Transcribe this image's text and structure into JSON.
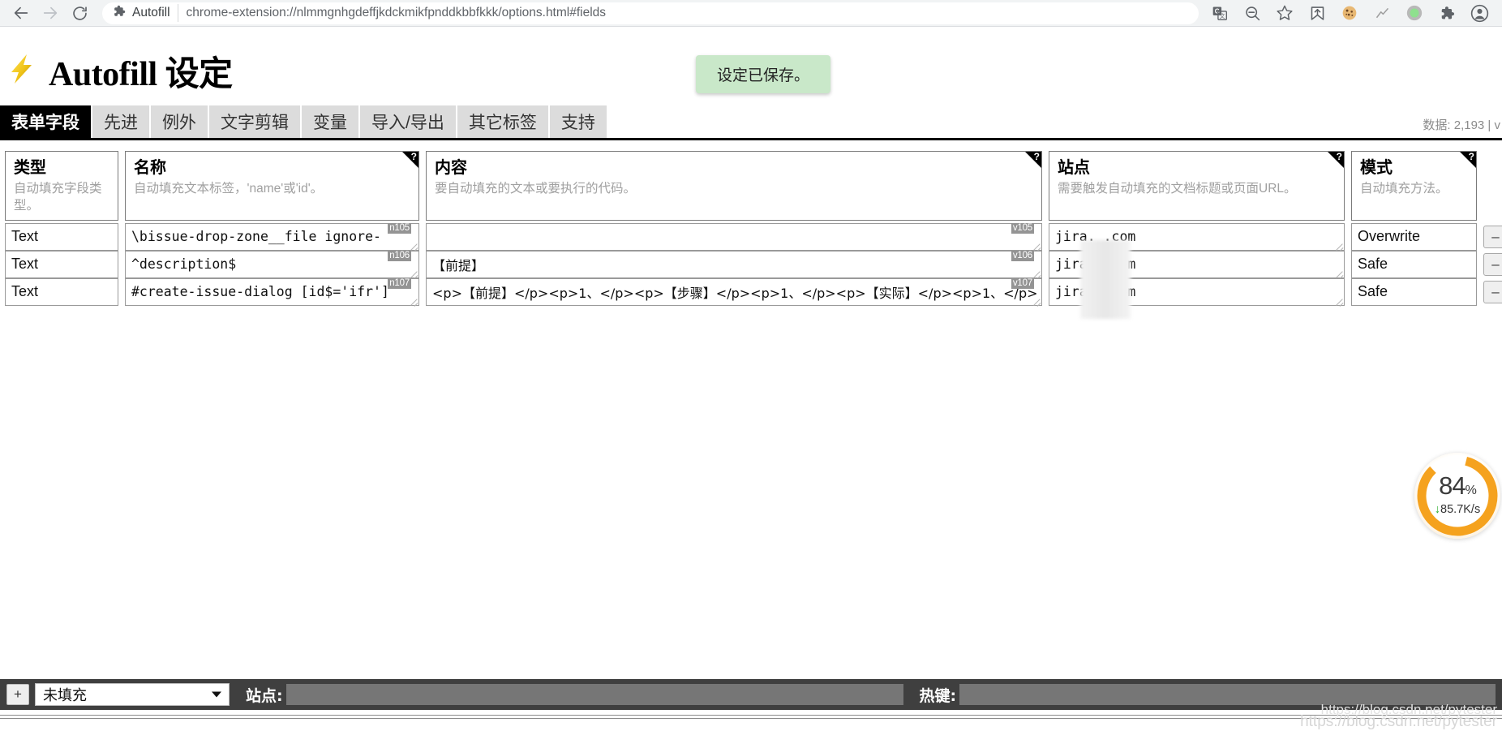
{
  "browser": {
    "back_icon": "back-arrow-icon",
    "forward_icon": "forward-arrow-icon",
    "reload_icon": "reload-icon",
    "extension_chip_icon": "puzzle-piece-icon",
    "extension_name": "Autofill",
    "url": "chrome-extension://nlmmgnhgdeffjkdckmikfpnddkbbfkkk/options.html#fields",
    "toolbar_icons": [
      {
        "name": "translate-icon"
      },
      {
        "name": "zoom-out-icon"
      },
      {
        "name": "bookmark-star-icon"
      },
      {
        "name": "pocket-save-icon"
      },
      {
        "name": "cookie-icon"
      },
      {
        "name": "autofill-lightning-icon"
      },
      {
        "name": "green-dot-record-icon"
      },
      {
        "name": "extensions-puzzle-icon"
      },
      {
        "name": "profile-avatar-icon"
      }
    ]
  },
  "header": {
    "logo_icon": "lightning-bolt-icon",
    "title": "Autofill 设定",
    "toast": "设定已保存。"
  },
  "tabs": [
    {
      "label": "表单字段",
      "active": true
    },
    {
      "label": "先进",
      "active": false
    },
    {
      "label": "例外",
      "active": false
    },
    {
      "label": "文字剪辑",
      "active": false
    },
    {
      "label": "变量",
      "active": false
    },
    {
      "label": "导入/导出",
      "active": false
    },
    {
      "label": "其它标签",
      "active": false
    },
    {
      "label": "支持",
      "active": false
    }
  ],
  "data_count": "数据: 2,193  |  v",
  "table": {
    "headers": [
      {
        "title": "类型",
        "desc": "自动填充字段类型。",
        "help": false,
        "help_mark": "?"
      },
      {
        "title": "名称",
        "desc": "自动填充文本标签，'name'或'id'。",
        "help": true,
        "help_mark": "?"
      },
      {
        "title": "内容",
        "desc": "要自动填充的文本或要执行的代码。",
        "help": true,
        "help_mark": "?"
      },
      {
        "title": "站点",
        "desc": "需要触发自动填充的文档标题或页面URL。",
        "help": true,
        "help_mark": "?"
      },
      {
        "title": "模式",
        "desc": "自动填充方法。",
        "help": true,
        "help_mark": "?"
      }
    ],
    "rows": [
      {
        "type": "Text",
        "name": "\\bissue-drop-zone__file ignore-",
        "name_badge": "n105",
        "value": "",
        "value_badge": "v105",
        "site": "jira.                    .com",
        "mode": "Overwrite",
        "remove_label": "–",
        "more_label": "›"
      },
      {
        "type": "Text",
        "name": "^description$",
        "name_badge": "n106",
        "value": "【前提】",
        "value_badge": "v106",
        "site": "jira.                    .com",
        "mode": "Safe",
        "remove_label": "–",
        "more_label": "›"
      },
      {
        "type": "Text",
        "name": "#create-issue-dialog  [id$='ifr']",
        "name_badge": "n107",
        "value": "<p>【前提】</p><p>1、</p><p>【步骤】</p><p>1、</p><p>【实际】</p><p>1、</p>",
        "value_badge": "v107",
        "site": "jira.                    .com",
        "mode": "Safe",
        "remove_label": "–",
        "more_label": "›"
      }
    ]
  },
  "bottom_bar": {
    "add_label": "+",
    "type_select_value": "未填充",
    "site_label": "站点:",
    "site_value": "",
    "hotkey_label": "热键:",
    "hotkey_value": ""
  },
  "download_widget": {
    "percent_text": "84",
    "percent_unit": "%",
    "percent_value": 84,
    "speed_arrow": "↓",
    "speed_text": "85.7K/s",
    "ring_color": "#f5a21e",
    "track_color": "#ffffff"
  },
  "watermark": "https://blog.csdn.net/pytester"
}
